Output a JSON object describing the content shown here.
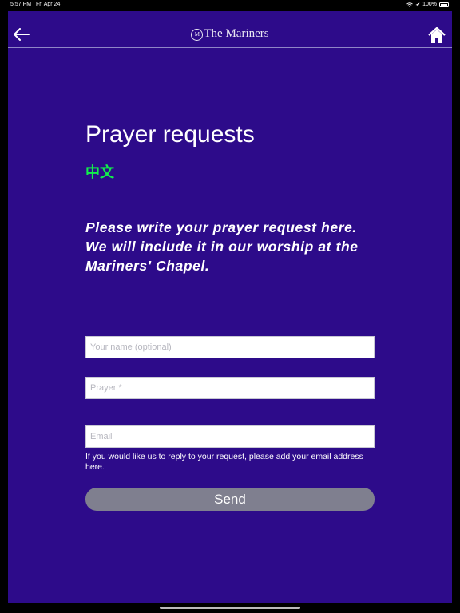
{
  "status": {
    "time": "5:57 PM",
    "date": "Fri Apr 24",
    "battery": "100%"
  },
  "nav": {
    "logo_letter": "M",
    "title": "The Mariners",
    "back_icon": "arrow-left-icon",
    "home_icon": "home-icon"
  },
  "page": {
    "heading": "Prayer requests",
    "language_link": "中文",
    "intro_lines": [
      "Please write your prayer request here.",
      "We will include it in our worship at the Mariners' Chapel."
    ]
  },
  "form": {
    "name_placeholder": "Your name (optional)",
    "prayer_placeholder": "Prayer *",
    "email_placeholder": "Email",
    "email_note": "If you would like us to reply to your request, please add your email address here.",
    "send_label": "Send"
  },
  "colors": {
    "background": "#2d0b8a",
    "language_link": "#11f04a",
    "send_button": "#7f7f8f"
  }
}
